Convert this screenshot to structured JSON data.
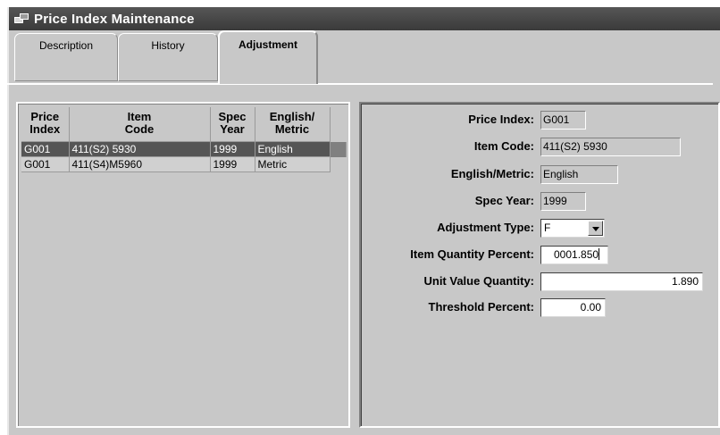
{
  "window": {
    "title": "Price Index Maintenance"
  },
  "tabs": [
    {
      "label": "Description"
    },
    {
      "label": "History"
    },
    {
      "label": "Adjustment"
    }
  ],
  "grid": {
    "headers": {
      "price_index": [
        "Price",
        "Index"
      ],
      "item_code": [
        "Item",
        "Code"
      ],
      "spec_year": [
        "Spec",
        "Year"
      ],
      "english_metric": [
        "English/",
        "Metric"
      ]
    },
    "rows": [
      {
        "price_index": "G001",
        "item_code": "411(S2) 5930",
        "spec_year": "1999",
        "english_metric": "English"
      },
      {
        "price_index": "G001",
        "item_code": "411(S4)M5960",
        "spec_year": "1999",
        "english_metric": "Metric"
      }
    ],
    "selected_row": 0
  },
  "detail": {
    "price_index_label": "Price Index:",
    "price_index_value": "G001",
    "item_code_label": "Item Code:",
    "item_code_value": "411(S2) 5930",
    "english_metric_label": "English/Metric:",
    "english_metric_value": "English",
    "spec_year_label": "Spec Year:",
    "spec_year_value": "1999",
    "adjustment_type_label": "Adjustment Type:",
    "adjustment_type_value": "F",
    "item_quantity_percent_label": "Item Quantity Percent:",
    "item_quantity_percent_value": "0001.850",
    "unit_value_quantity_label": "Unit Value Quantity:",
    "unit_value_quantity_value": "1.890",
    "threshold_percent_label": "Threshold Percent:",
    "threshold_percent_value": "0.00"
  }
}
